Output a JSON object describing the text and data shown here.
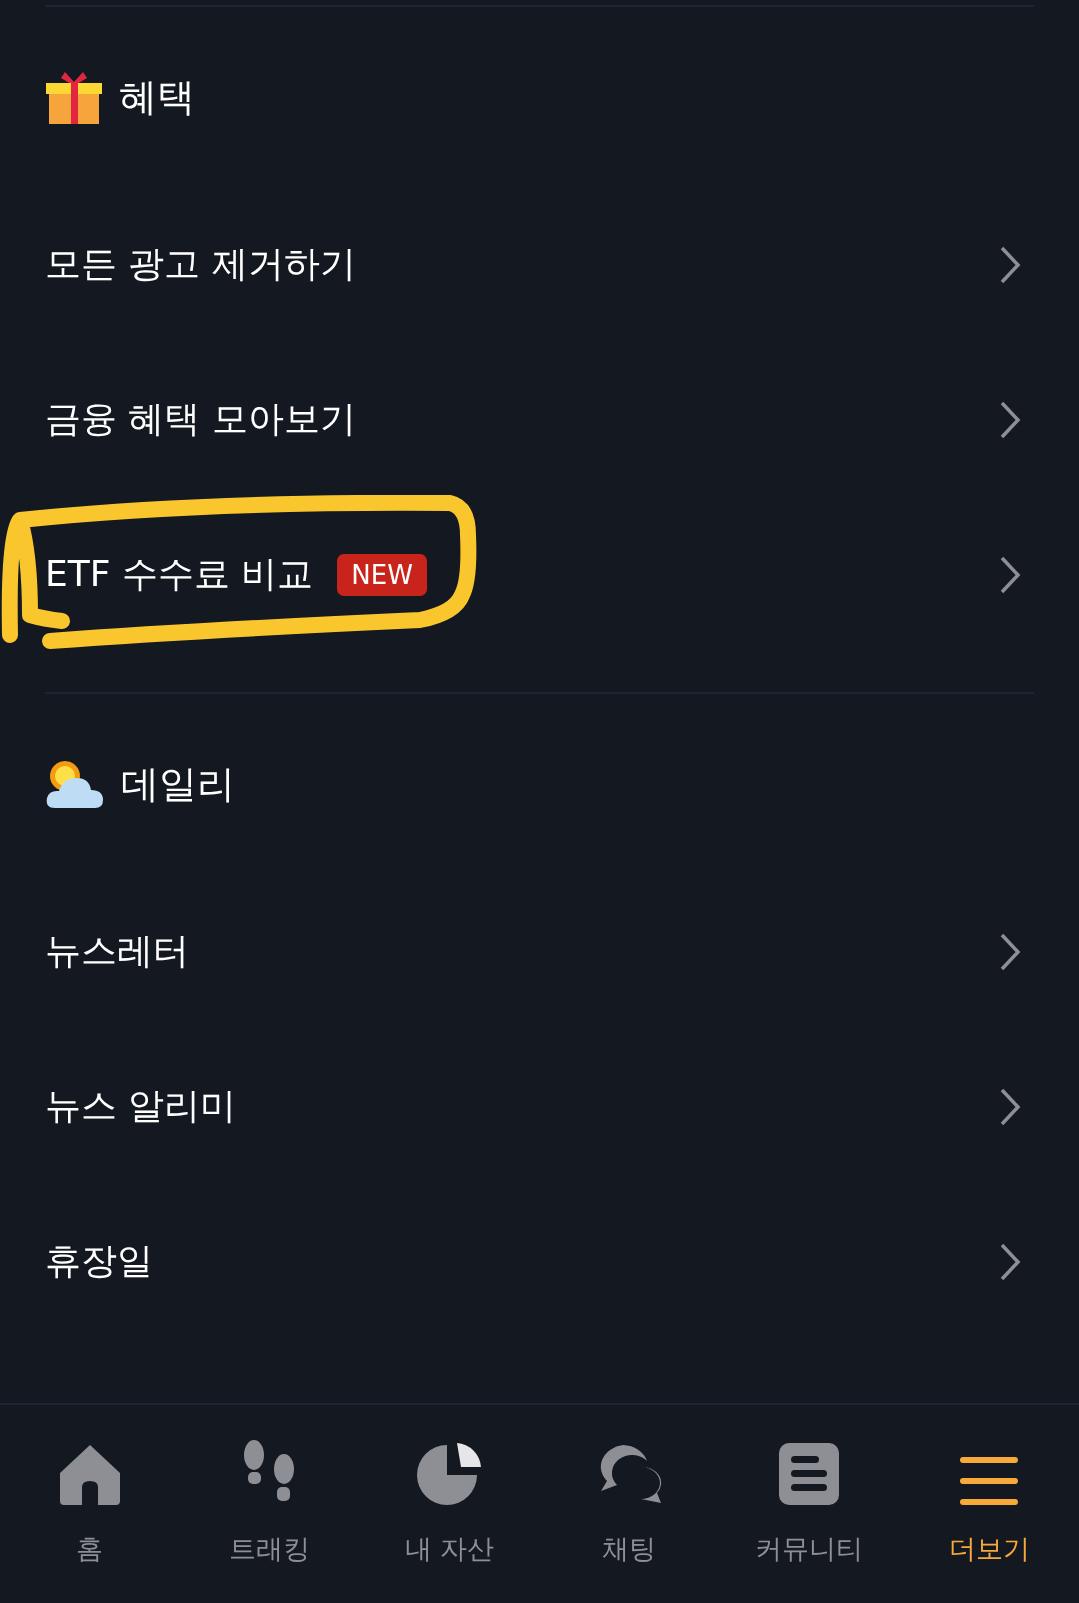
{
  "sections": [
    {
      "kind": "gift",
      "title": "혜택",
      "items": [
        {
          "label": "모든 광고 제거하기",
          "highlighted": false
        },
        {
          "label": "금융 혜택 모아보기",
          "highlighted": false
        },
        {
          "label": "ETF 수수료 비교",
          "badge": "NEW",
          "highlighted": true
        }
      ]
    },
    {
      "kind": "weather",
      "title": "데일리",
      "items": [
        {
          "label": "뉴스레터",
          "highlighted": false
        },
        {
          "label": "뉴스 알리미",
          "highlighted": false
        },
        {
          "label": "휴장일",
          "highlighted": false
        }
      ]
    }
  ],
  "tab_bar": [
    {
      "kind": "home",
      "label": "홈",
      "selected": false
    },
    {
      "kind": "tracking",
      "label": "트래킹",
      "selected": false
    },
    {
      "kind": "assets",
      "label": "내 자산",
      "selected": false
    },
    {
      "kind": "chat",
      "label": "채팅",
      "selected": false
    },
    {
      "kind": "community",
      "label": "커뮤니티",
      "selected": false
    },
    {
      "kind": "more",
      "label": "더보기",
      "selected": true
    }
  ]
}
